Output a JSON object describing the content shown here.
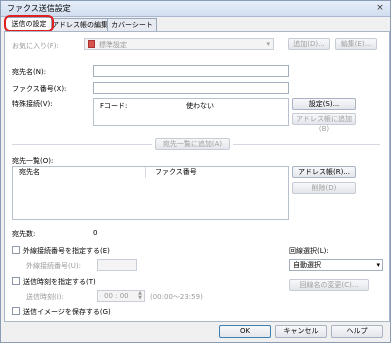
{
  "window": {
    "title": "ファクス送信設定",
    "close_label": "×"
  },
  "tabs": [
    {
      "label": "送信の設定"
    },
    {
      "label": "アドレス帳の編集"
    },
    {
      "label": "カバーシート"
    }
  ],
  "favorites": {
    "label": "お気に入り(F):",
    "value": "標準設定",
    "add_button": "追加(D)...",
    "edit_button": "編集(E)..."
  },
  "recipient": {
    "name_label": "宛先名(N):",
    "name_value": "",
    "fax_label": "ファクス番号(X):",
    "fax_value": ""
  },
  "special_line": {
    "label": "特殊接続(V):",
    "col1": "Fコード:",
    "col2": "使わない",
    "settings_button": "設定(S)...",
    "addr_add_button": "アドレス帳に追加(B)"
  },
  "add_to_list_button": "宛先一覧に追加(A)",
  "recipient_list": {
    "label": "宛先一覧(O):",
    "col_name": "宛先名",
    "col_fax": "ファクス番号",
    "addressbook_button": "アドレス帳(R)...",
    "delete_button": "削除(D)"
  },
  "count": {
    "label": "宛先数:",
    "value": "0"
  },
  "outside_line": {
    "checkbox_label": "外線接続番号を指定する(E)",
    "field_label": "外線接続番号(U):",
    "field_value": ""
  },
  "send_time": {
    "checkbox_label": "送信時刻を指定する(T)",
    "field_label": "送信時刻(I):",
    "time_value": "00 : 00",
    "time_range": "(00:00〜23:59)"
  },
  "save_image": {
    "checkbox_label": "送信イメージを保存する(G)"
  },
  "line_select": {
    "label": "回線選択(L):",
    "value": "自動選択",
    "line_name_button": "回線名の変更(C)..."
  },
  "footer": {
    "ok": "OK",
    "cancel": "キャンセル",
    "help": "ヘルプ"
  }
}
